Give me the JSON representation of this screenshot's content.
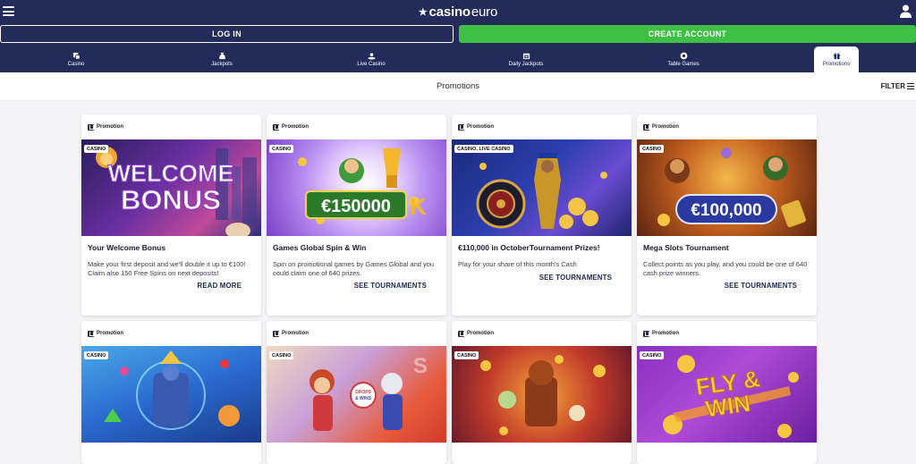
{
  "header": {
    "logo_main": "casino",
    "logo_sub": "euro",
    "login_label": "LOG IN",
    "create_label": "CREATE ACCOUNT"
  },
  "nav": {
    "items": [
      {
        "label": "Casino",
        "icon": "dice-icon"
      },
      {
        "label": "Jackpots",
        "icon": "money-bag-icon"
      },
      {
        "label": "Live Casino",
        "icon": "dealer-icon"
      },
      {
        "label": "Daily Jackpots",
        "icon": "calendar-icon"
      },
      {
        "label": "Table Games",
        "icon": "chip-icon"
      },
      {
        "label": "Promotions",
        "icon": "gift-icon"
      }
    ],
    "active": "Promotions"
  },
  "subheader": {
    "title": "Promotions",
    "filter_label": "FILTER"
  },
  "cards": [
    {
      "tag": "Promotion",
      "badge": "CASINO",
      "banner_text": "WELCOME BONUS",
      "title": "Your Welcome Bonus",
      "desc": "Make your first deposit and we'll double it up to €100! Claim also 150 Free Spins on next deposits!",
      "cta": "READ MORE"
    },
    {
      "tag": "Promotion",
      "badge": "CASINO",
      "banner_text": "€150000",
      "title": "Games Global Spin & Win",
      "desc": "Spin on promotional games by Games Global and you could claim one of 640 prizes.",
      "cta": "SEE TOURNAMENTS"
    },
    {
      "tag": "Promotion",
      "badge": "CASINO, LIVE CASINO",
      "banner_text": "",
      "title": "€110,000 in OctoberTournament Prizes!",
      "desc": "Play for your share of this month's Cash",
      "cta": "SEE TOURNAMENTS"
    },
    {
      "tag": "Promotion",
      "badge": "CASINO",
      "banner_text": "€100,000",
      "title": "Mega Slots Tournament",
      "desc": "Collect points as you play, and you could be one of 640 cash prize winners.",
      "cta": "SEE TOURNAMENTS"
    },
    {
      "tag": "Promotion",
      "badge": "CASINO"
    },
    {
      "tag": "Promotion",
      "badge": "CASINO",
      "banner_text": "DROPS & WINS"
    },
    {
      "tag": "Promotion",
      "badge": "CASINO"
    },
    {
      "tag": "Promotion",
      "badge": "CASINO",
      "banner_text": "FLY & WIN"
    }
  ],
  "colors": {
    "navy": "#232b5a",
    "green": "#3ec044",
    "page_bg": "#f4f4f6"
  }
}
